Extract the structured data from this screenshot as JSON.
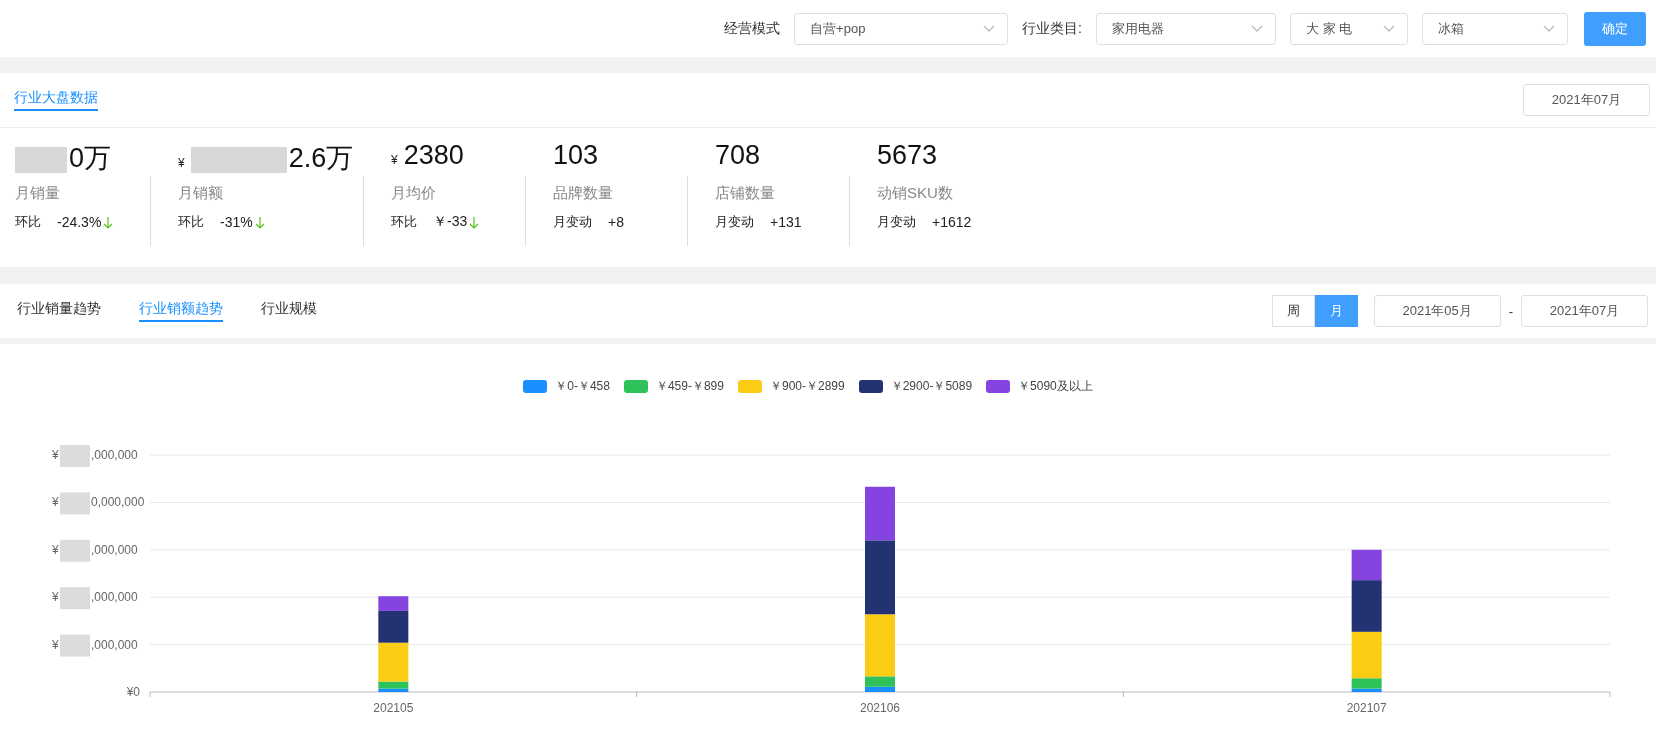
{
  "filters": [
    {
      "kind": "label",
      "text": "经营模式"
    },
    {
      "kind": "select",
      "value": "自营+pop"
    },
    {
      "kind": "label",
      "text": "行业类目:"
    },
    {
      "kind": "select",
      "value": "家用电器"
    },
    {
      "kind": "select",
      "value": "大 家 电"
    },
    {
      "kind": "select",
      "value": "冰箱"
    }
  ],
  "confirm_button": "确定",
  "overview": {
    "title": "行业大盘数据",
    "date": "2021年07月",
    "stats": [
      {
        "value": "0万",
        "blurred": true,
        "label": "月销量",
        "change_label": "环比",
        "change": "-24.3%",
        "falling": true
      },
      {
        "currency": "¥",
        "value": "2.6万",
        "blurred": true,
        "label": "月销额",
        "change_label": "环比",
        "change": "-31%",
        "falling": true
      },
      {
        "currency": "¥",
        "value": "2380",
        "blurred": false,
        "label": "月均价",
        "change_label": "环比",
        "change": "￥-33",
        "falling": true
      },
      {
        "value": "103",
        "blurred": false,
        "label": "品牌数量",
        "change_label": "月变动",
        "change": "+8",
        "falling": false
      },
      {
        "value": "708",
        "blurred": false,
        "label": "店铺数量",
        "change_label": "月变动",
        "change": "+131",
        "falling": false
      },
      {
        "value": "5673",
        "blurred": false,
        "label": "动销SKU数",
        "change_label": "月变动",
        "change": "+1612",
        "falling": false
      }
    ]
  },
  "trend_tabs": [
    {
      "label": "行业销量趋势",
      "selected": false
    },
    {
      "label": "行业销额趋势",
      "selected": true
    },
    {
      "label": "行业规模",
      "selected": false
    }
  ],
  "period_toggle": [
    {
      "label": "周",
      "selected": false
    },
    {
      "label": "月",
      "selected": true
    }
  ],
  "date_range": {
    "start": "2021年05月",
    "separator": "-",
    "end": "2021年07月"
  },
  "chart_legend": [
    {
      "label": "￥0-￥458",
      "color": "#1890ff"
    },
    {
      "label": "￥459-￥899",
      "color": "#2fc25b"
    },
    {
      "label": "￥900-￥2899",
      "color": "#facc14"
    },
    {
      "label": "￥2900-￥5089",
      "color": "#223273"
    },
    {
      "label": "￥5090及以上",
      "color": "#8543e0"
    }
  ],
  "y_axis_labels": [
    {
      "kind": "blurred",
      "prefix": "¥",
      "text": ",000,000"
    },
    {
      "kind": "blurred",
      "prefix": "¥",
      "text": "0,000,000"
    },
    {
      "kind": "blurred",
      "prefix": "¥",
      "text": ",000,000"
    },
    {
      "kind": "blurred",
      "prefix": "¥",
      "text": ",000,000"
    },
    {
      "kind": "blurred",
      "prefix": "¥",
      "text": ",000,000"
    },
    {
      "kind": "plain",
      "text": "¥0"
    }
  ],
  "x_axis_labels": [
    "202105",
    "202106",
    "202107"
  ]
}
